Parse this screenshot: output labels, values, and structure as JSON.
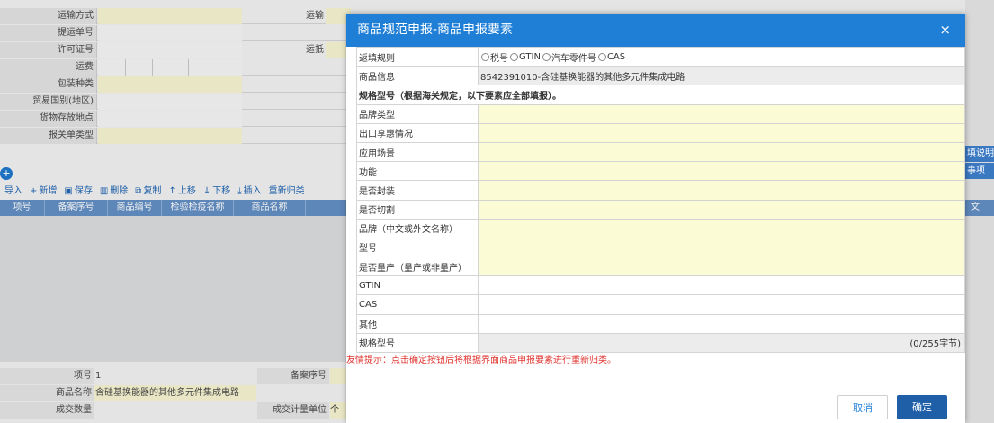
{
  "background_form": {
    "rows": [
      {
        "label": "运输方式",
        "right_label": "运输"
      },
      {
        "label": "提运单号",
        "right_label": ""
      },
      {
        "label": "许可证号",
        "right_label": "运抵"
      },
      {
        "label": "运费",
        "right_label": ""
      },
      {
        "label": "包装种类",
        "right_label": ""
      },
      {
        "label": "贸易国别(地区)",
        "right_label": ""
      },
      {
        "label": "货物存放地点",
        "right_label": ""
      },
      {
        "label": "报关单类型",
        "right_label": ""
      }
    ],
    "toolbar": [
      {
        "icon": "",
        "label": "导入"
      },
      {
        "icon": "+",
        "label": "新增"
      },
      {
        "icon": "▣",
        "label": "保存"
      },
      {
        "icon": "▥",
        "label": "删除"
      },
      {
        "icon": "⧉",
        "label": "复制"
      },
      {
        "icon": "↑",
        "label": "上移"
      },
      {
        "icon": "↓",
        "label": "下移"
      },
      {
        "icon": "⤓",
        "label": "插入"
      },
      {
        "icon": "",
        "label": "重新归类"
      }
    ],
    "table_headers": [
      "项号",
      "备案序号",
      "商品编号",
      "检验检疫名称",
      "商品名称"
    ],
    "bottom_rows": [
      {
        "label": "项号",
        "value": "1",
        "right_label": "备案序号",
        "right_value": ""
      },
      {
        "label": "商品名称",
        "value": "含硅基换能器的其他多元件集成电路",
        "right_label": "",
        "right_value": ""
      },
      {
        "label": "成交数量",
        "value": "",
        "right_label": "成交计量单位",
        "right_value": "个"
      }
    ],
    "right_strip": {
      "btn1": "填说明",
      "btn2": "事项",
      "col": "文"
    }
  },
  "dialog": {
    "title": "商品规范申报-商品申报要素",
    "close": "×",
    "fill_rule_label": "返填规则",
    "fill_rule_options": [
      "税号",
      "GTIN",
      "汽车零件号",
      "CAS"
    ],
    "goods_info_label": "商品信息",
    "goods_info_value": "8542391010-含硅基换能器的其他多元件集成电路",
    "spec_heading": "规格型号（根据海关规定，以下要素应全部填报）。",
    "fields": [
      {
        "label": "品牌类型",
        "value": "",
        "required": true
      },
      {
        "label": "出口享惠情况",
        "value": "",
        "required": true
      },
      {
        "label": "应用场景",
        "value": "",
        "required": true
      },
      {
        "label": "功能",
        "value": "",
        "required": true
      },
      {
        "label": "是否封装",
        "value": "",
        "required": true
      },
      {
        "label": "是否切割",
        "value": "",
        "required": true
      },
      {
        "label": "品牌（中文或外文名称）",
        "value": "",
        "required": true
      },
      {
        "label": "型号",
        "value": "",
        "required": true
      },
      {
        "label": "是否量产（量产或非量产）",
        "value": "",
        "required": true
      },
      {
        "label": "GTIN",
        "value": "",
        "required": false
      },
      {
        "label": "CAS",
        "value": "",
        "required": false
      },
      {
        "label": "其他",
        "value": "",
        "required": false
      }
    ],
    "spec_model_label": "规格型号",
    "spec_model_bytes": "(0/255字节)",
    "tip": "友情提示：点击确定按钮后将根据界面商品申报要素进行重新归类。",
    "cancel_label": "取消",
    "ok_label": "确定"
  }
}
